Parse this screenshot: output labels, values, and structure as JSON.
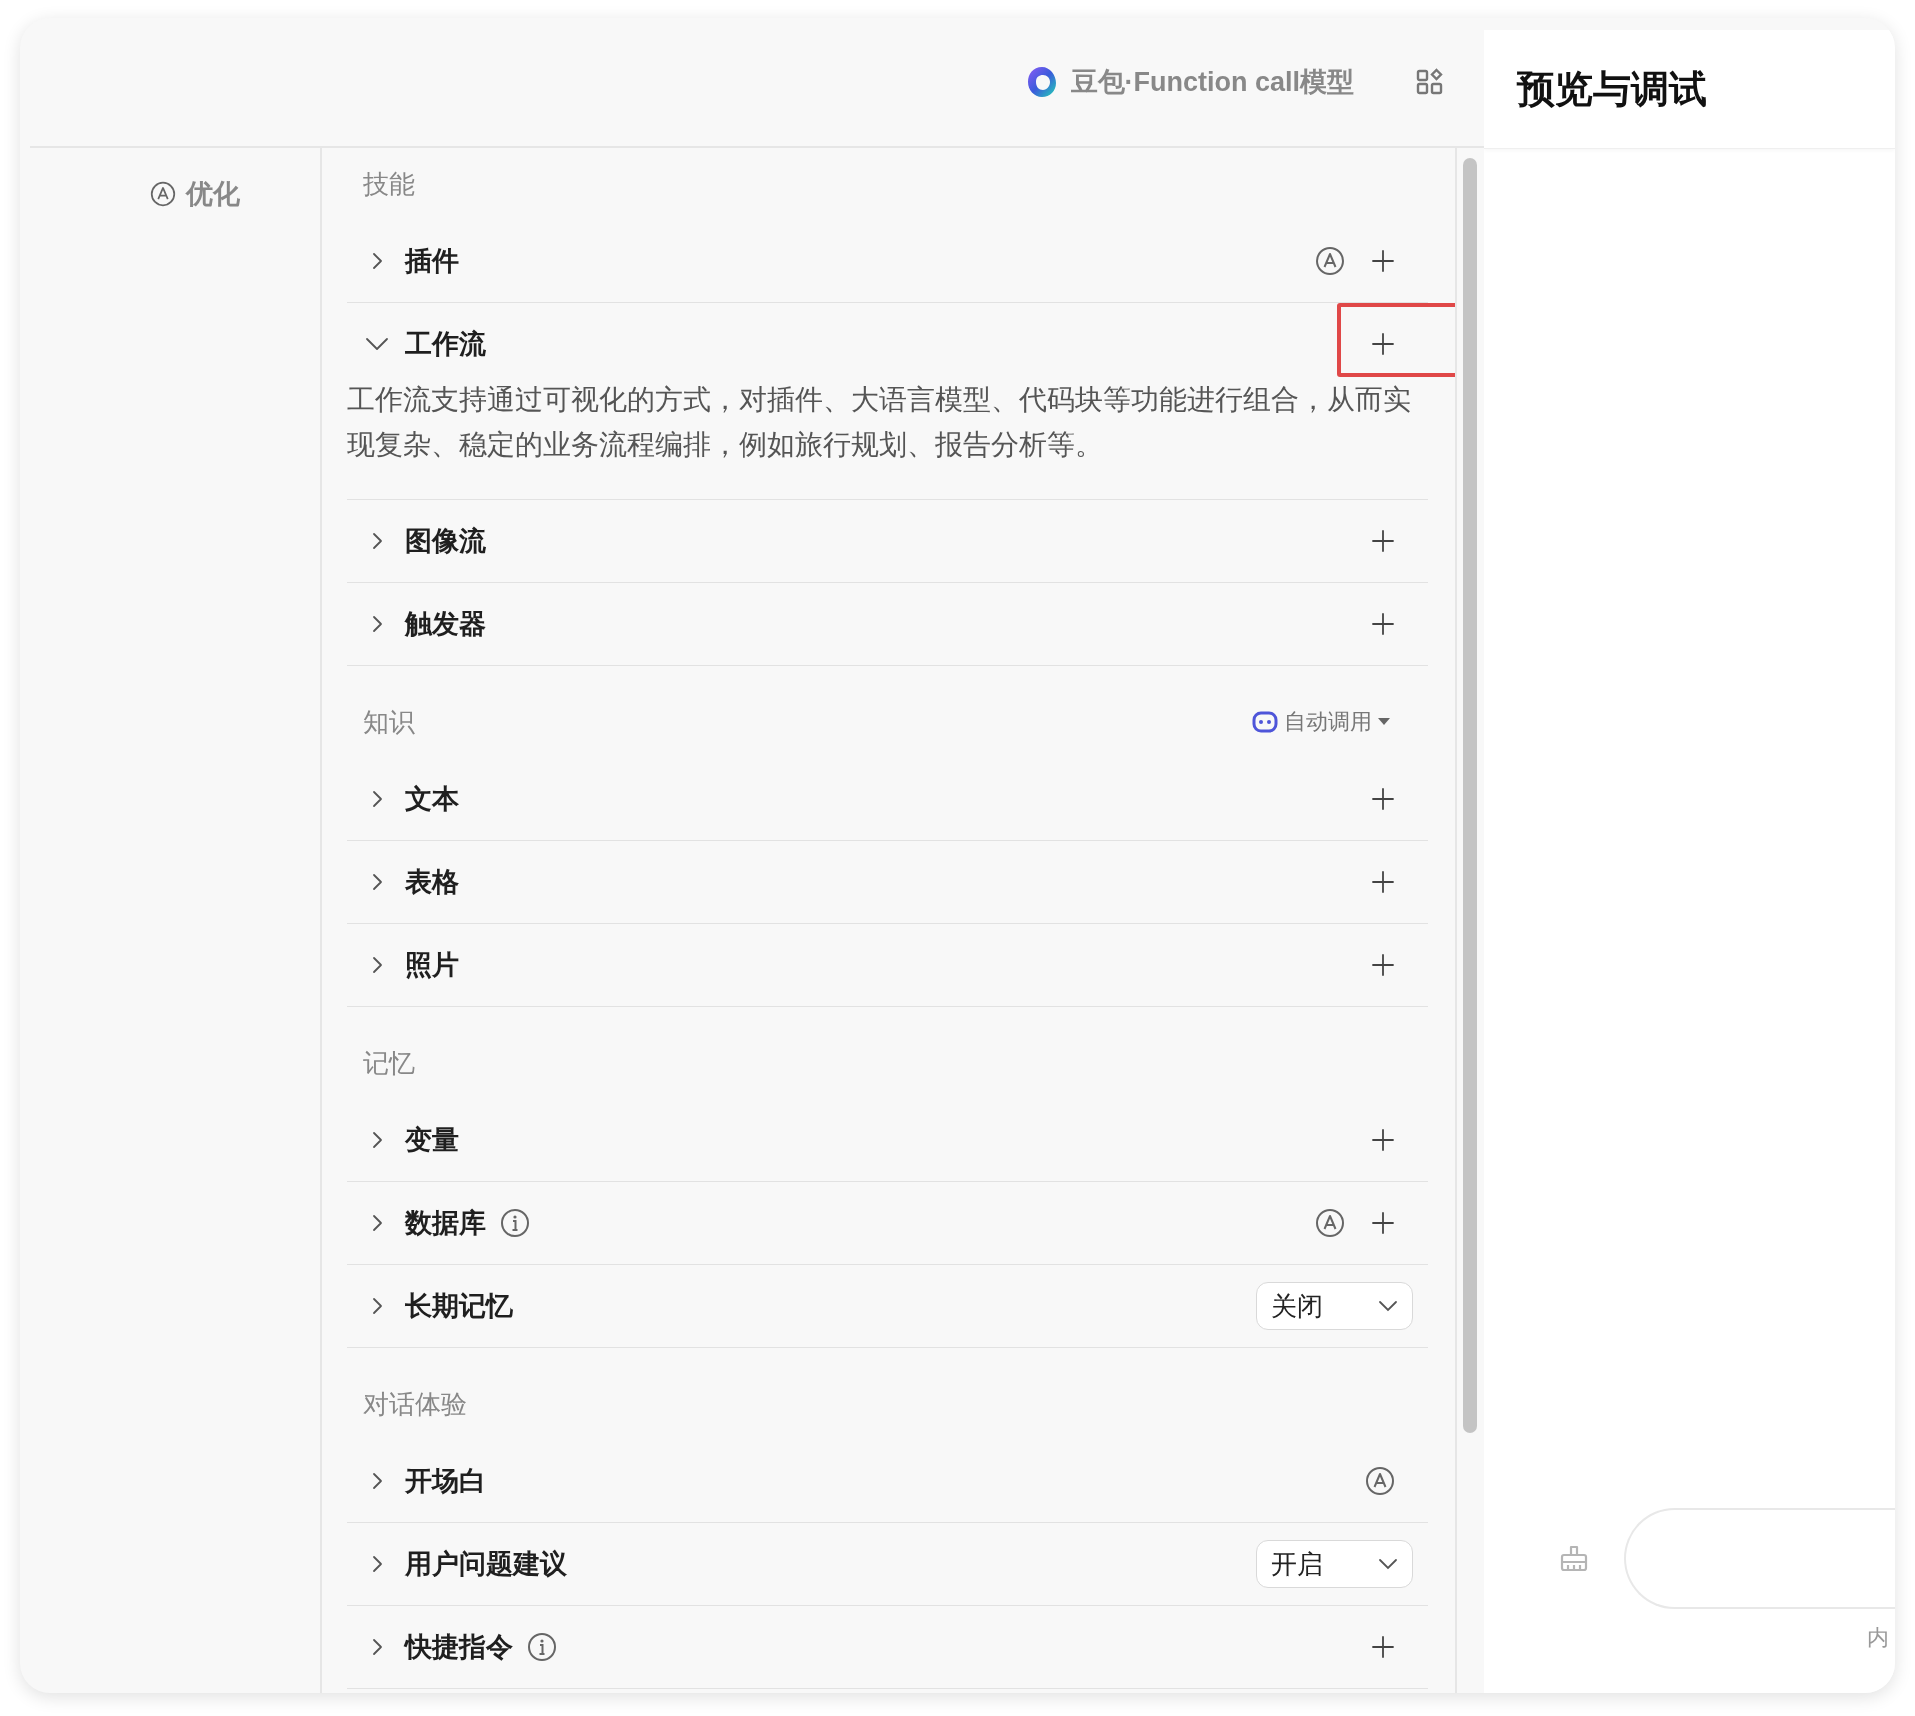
{
  "header": {
    "model_name": "豆包·Function call模型"
  },
  "sidebar": {
    "optimize_label": "优化"
  },
  "sections": [
    {
      "title": "技能",
      "items": [
        {
          "label": "插件",
          "expanded": false,
          "highlighted": false,
          "auto": true,
          "add": true
        },
        {
          "label": "工作流",
          "expanded": true,
          "highlighted": true,
          "add": true,
          "description": "工作流支持通过可视化的方式，对插件、大语言模型、代码块等功能进行组合，从而实现复杂、稳定的业务流程编排，例如旅行规划、报告分析等。"
        },
        {
          "label": "图像流",
          "expanded": false,
          "highlighted": false,
          "add": true
        },
        {
          "label": "触发器",
          "expanded": false,
          "highlighted": false,
          "add": true
        }
      ]
    },
    {
      "title": "知识",
      "auto_call": "自动调用",
      "items": [
        {
          "label": "文本",
          "expanded": false,
          "highlighted": false,
          "add": true
        },
        {
          "label": "表格",
          "expanded": false,
          "highlighted": false,
          "add": true
        },
        {
          "label": "照片",
          "expanded": false,
          "highlighted": false,
          "add": true
        }
      ]
    },
    {
      "title": "记忆",
      "items": [
        {
          "label": "变量",
          "expanded": false,
          "highlighted": false,
          "add": true
        },
        {
          "label": "数据库",
          "expanded": false,
          "highlighted": false,
          "info": true,
          "auto": true,
          "add": true
        },
        {
          "label": "长期记忆",
          "expanded": false,
          "highlighted": false,
          "dropdown": "关闭"
        }
      ]
    },
    {
      "title": "对话体验",
      "items": [
        {
          "label": "开场白",
          "expanded": false,
          "highlighted": false,
          "auto": true
        },
        {
          "label": "用户问题建议",
          "expanded": false,
          "highlighted": false,
          "dropdown": "开启"
        },
        {
          "label": "快捷指令",
          "expanded": false,
          "highlighted": false,
          "info": true,
          "add": true
        }
      ]
    }
  ],
  "preview": {
    "title": "预览与调试",
    "hint": "内"
  }
}
